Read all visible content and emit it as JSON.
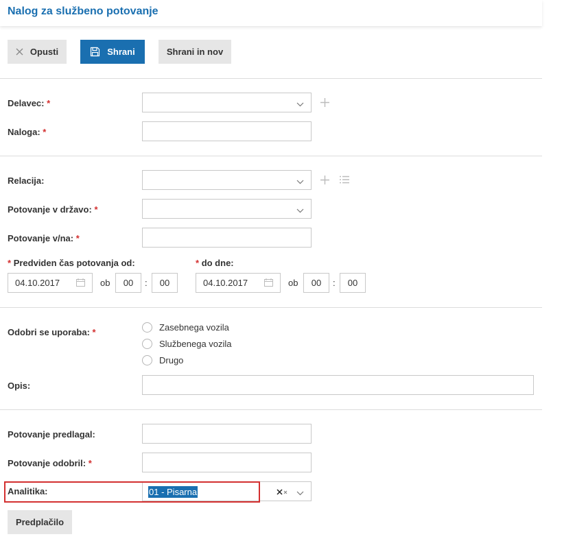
{
  "header": {
    "title": "Nalog za službeno potovanje"
  },
  "toolbar": {
    "cancel_label": "Opusti",
    "save_label": "Shrani",
    "save_new_label": "Shrani in nov"
  },
  "form": {
    "delavec_label": "Delavec:",
    "naloga_label": "Naloga:",
    "relacija_label": "Relacija:",
    "drzava_label": "Potovanje v državo:",
    "vna_label": "Potovanje v/na:",
    "od_label": "Predviden čas potovanja od:",
    "do_label": "do dne:",
    "date_from": "04.10.2017",
    "date_to": "04.10.2017",
    "ob_label": "ob",
    "colon": ":",
    "hour_from": "00",
    "minute_from": "00",
    "hour_to": "00",
    "minute_to": "00",
    "odobri_label": "Odobri se uporaba:",
    "radio_options": [
      "Zasebnega vozila",
      "Službenega vozila",
      "Drugo"
    ],
    "opis_label": "Opis:",
    "predlagal_label": "Potovanje predlagal:",
    "odobril_label": "Potovanje odobril:",
    "analitika_label": "Analitika:",
    "analitika_value": "01 - Pisarna",
    "required_mark": "*"
  },
  "footer": {
    "predplacilo_label": "Predplačilo"
  },
  "colors": {
    "accent": "#1a6fb0",
    "required": "#d32f2f",
    "highlight": "#d32f2f"
  },
  "icons": [
    "close-icon",
    "save-icon",
    "chevron-down-icon",
    "plus-icon",
    "list-icon",
    "calendar-icon",
    "clear-icon"
  ]
}
